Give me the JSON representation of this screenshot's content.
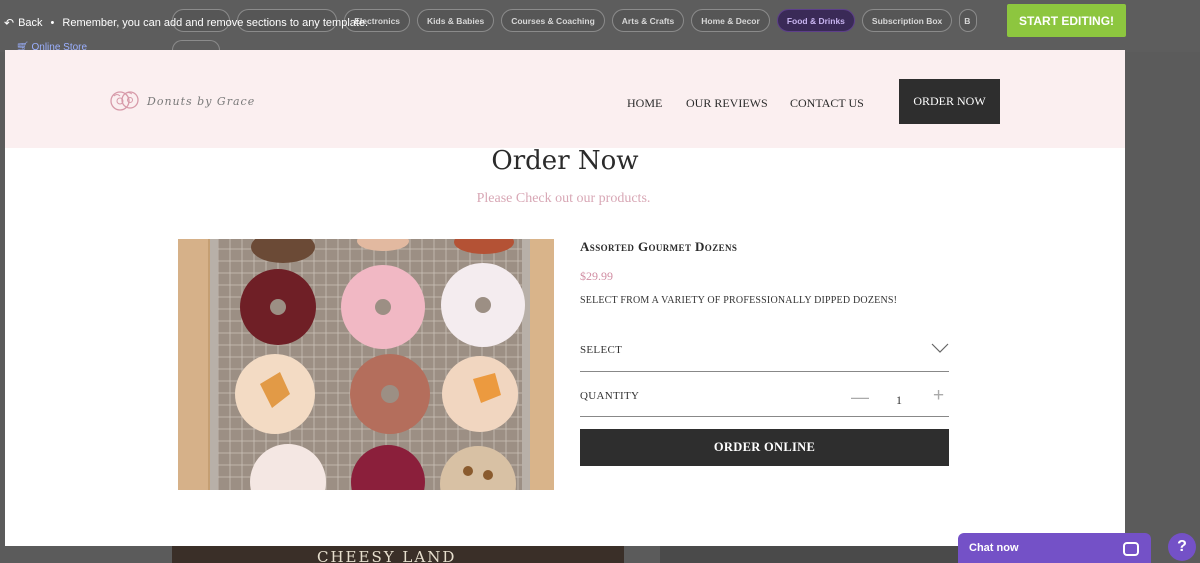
{
  "editor": {
    "back_label": "Back",
    "hint": "Remember, you can add and remove sections to any template.",
    "categories": [
      "Electronics",
      "Kids & Babies",
      "Courses & Coaching",
      "Arts & Crafts",
      "Home & Decor",
      "Food & Drinks",
      "Subscription Box",
      "B"
    ],
    "active_category": "Food & Drinks",
    "online_store": "Online Store",
    "start_editing": "START EDITING!"
  },
  "site": {
    "logo_text": "Donuts by Grace",
    "nav": [
      "HOME",
      "OUR REVIEWS",
      "CONTACT US"
    ],
    "order_now_button": "ORDER NOW"
  },
  "section": {
    "title": "Order Now",
    "subtitle": "Please Check out our products."
  },
  "product": {
    "name": "Assorted Gourmet Dozens",
    "price": "$29.99",
    "description": "SELECT FROM A VARIETY OF PROFESSIONALLY DIPPED DOZENS!",
    "select_label": "SELECT",
    "quantity_label": "QUANTITY",
    "quantity": "1",
    "order_button": "ORDER ONLINE"
  },
  "footer": {
    "thumb_text": "CHEESY LAND",
    "chat_label": "Chat now",
    "help": "?"
  },
  "colors": {
    "header_bg": "#fbeff0",
    "accent_pink": "#d18ea3",
    "dark_button": "#2e2e2e",
    "start_green": "#8dc63f",
    "chat_purple": "#7451c7"
  }
}
